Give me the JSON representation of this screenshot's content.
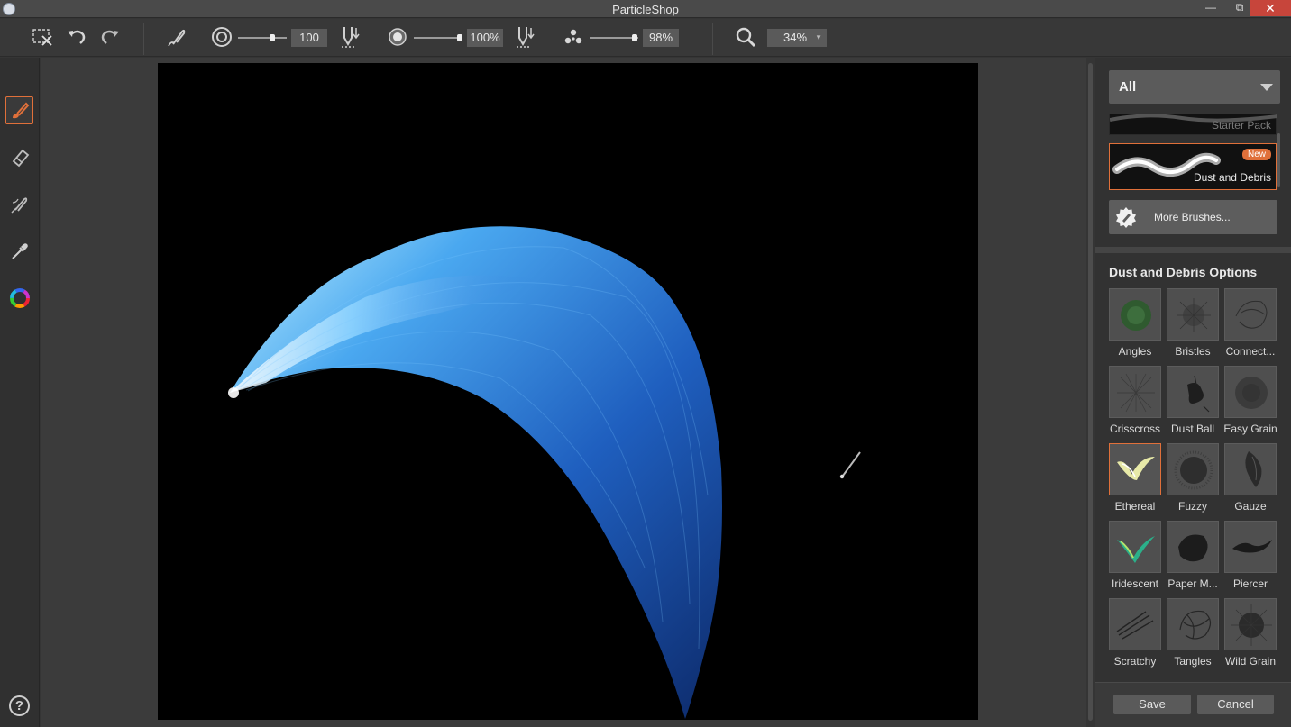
{
  "window": {
    "title": "ParticleShop",
    "minimize": "—",
    "restore": "⧉",
    "close": "✕"
  },
  "toolbar": {
    "size_value": "100",
    "opacity_value": "100%",
    "density_value": "98%",
    "zoom_value": "34%",
    "size_level": 0.72,
    "opacity_level": 1.0,
    "density_level": 0.98
  },
  "brush_panel": {
    "category": "All",
    "packs": [
      {
        "name": "Starter Pack",
        "badge": ""
      },
      {
        "name": "Dust and Debris",
        "badge": "New"
      }
    ],
    "more_brushes": "More Brushes...",
    "options_title": "Dust and Debris Options",
    "brushes": [
      {
        "name": "Angles"
      },
      {
        "name": "Bristles"
      },
      {
        "name": "Connect..."
      },
      {
        "name": "Crisscross"
      },
      {
        "name": "Dust Ball"
      },
      {
        "name": "Easy Grain"
      },
      {
        "name": "Ethereal"
      },
      {
        "name": "Fuzzy"
      },
      {
        "name": "Gauze"
      },
      {
        "name": "Iridescent"
      },
      {
        "name": "Paper M..."
      },
      {
        "name": "Piercer"
      },
      {
        "name": "Scratchy"
      },
      {
        "name": "Tangles"
      },
      {
        "name": "Wild Grain"
      }
    ],
    "selected_brush": "Ethereal",
    "save": "Save",
    "cancel": "Cancel"
  },
  "help": "?",
  "colors": {
    "accent": "#e0703a",
    "badge": "#e0703a",
    "stroke_highlight": "#eaf8ff",
    "stroke_blue": "#2f7fe0"
  }
}
